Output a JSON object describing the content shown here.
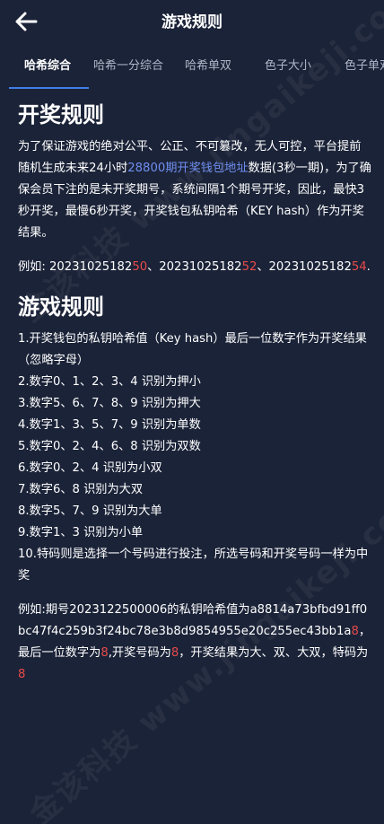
{
  "header": {
    "title": "游戏规则",
    "back_icon": "arrow-left-icon"
  },
  "tabs": [
    {
      "label": "哈希综合",
      "active": true
    },
    {
      "label": "哈希一分综合",
      "active": false
    },
    {
      "label": "哈希单双",
      "active": false
    },
    {
      "label": "色子大小",
      "active": false
    },
    {
      "label": "色子单双",
      "active": false
    }
  ],
  "colors": {
    "background": "#1b2338",
    "accent": "#3f7de8",
    "link": "#6f8ef0",
    "highlight": "#e84a4a"
  },
  "section1": {
    "heading": "开奖规则",
    "para_part1": "为了保证游戏的绝对公平、公正、不可篡改，无人可控，平台提前随机生成未来24小时",
    "para_link": "28800期开奖钱包地址",
    "para_part2": "数据(3秒一期)，为了确保会员下注的是未开奖期号，系统间隔1个期号开奖，因此，最快3秒开奖，最慢6秒开奖，开奖钱包私钥哈希（KEY hash）作为开奖结果。",
    "example_prefix": "例如: ",
    "example_items": [
      {
        "base": "20231025182",
        "tail": "50",
        "sep": "、"
      },
      {
        "base": "20231025182",
        "tail": "52",
        "sep": "、"
      },
      {
        "base": "20231025182",
        "tail": "54",
        "sep": "..."
      }
    ]
  },
  "section2": {
    "heading": "游戏规则",
    "rules": [
      "1.开奖钱包的私钥哈希值（Key hash）最后一位数字作为开奖结果（忽略字母）",
      "2.数字0、1、2、3、4 识别为押小",
      "3.数字5、6、7、8、9 识别为押大",
      "4.数字1、3、5、7、9 识别为单数",
      "5.数字0、2、4、6、8 识别为双数",
      "6.数字0、2、4 识别为小双",
      "7.数字6、8 识别为大双",
      "8.数字5、7、9 识别为大单",
      "9.数字1、3 识别为小单",
      "10.特码则是选择一个号码进行投注，所选号码和开奖号码一样为中奖"
    ],
    "example": {
      "p1": "例如:期号2023122500006的私钥哈希值为a8814a73bfbd91ff0bc47f4c259b3f24bc78e3b8d9854955e20c255ec43bb1a",
      "h1": "8",
      "p2": "，最后一位数字为",
      "h2": "8",
      "p3": ",开奖号码为",
      "h3": "8",
      "p4": "，开奖结果为大、双、大双，特码为",
      "h4": "8"
    }
  },
  "watermark": {
    "text": "金该科技 www.jingaikeji.com"
  }
}
